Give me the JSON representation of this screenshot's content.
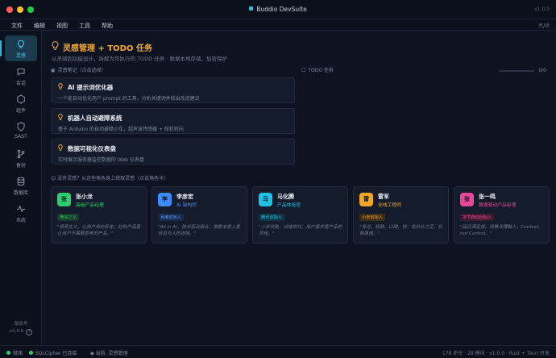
{
  "window": {
    "title": "Buddio DevSuite",
    "version": "v1.0.0",
    "traffic_lights": [
      "#ff5f57",
      "#febc2e",
      "#28c840"
    ]
  },
  "menu": {
    "items": [
      "文件",
      "编辑",
      "视图",
      "工具",
      "帮助"
    ],
    "theme": "亮/暗"
  },
  "sidebar": {
    "items": [
      {
        "label": "灵感",
        "icon": "bulb-icon",
        "active": true
      },
      {
        "label": "会话",
        "icon": "chat-icon"
      },
      {
        "label": "组件",
        "icon": "hexagon-icon"
      },
      {
        "label": "SAST",
        "icon": "shield-icon"
      },
      {
        "label": "备份",
        "icon": "git-branch-icon"
      },
      {
        "label": "数据库",
        "icon": "database-icon"
      },
      {
        "label": "系统",
        "icon": "activity-icon"
      }
    ],
    "footer_label": "版本号",
    "footer_version": "v1.0.0"
  },
  "page": {
    "title": "灵感管理 + TODO 任务",
    "subtitle": "从灵感到功能设计，拆解为可执行的 TODO 任务 · 数据本地存储，加密保护"
  },
  "ideas": {
    "heading": "灵感笔记（点击选择）",
    "items": [
      {
        "title": "AI 提示词优化器",
        "desc": "一个能自动优化用户 prompt 的工具，分析关键词并给出改进建议"
      },
      {
        "title": "机器人自动避障系统",
        "desc": "基于 Arduino 的自动避障小车，超声波传感器 + 舵机转向"
      },
      {
        "title": "数据可视化仪表盘",
        "desc": "实时展示服务器监控数据的 Web 仪表盘"
      }
    ]
  },
  "todo": {
    "heading": "TODO 任务",
    "count": "0/0",
    "progress": 0
  },
  "personas": {
    "cta": "没有灵感？从这些角色身上获取灵感（点击角色卡）",
    "items": [
      {
        "avatar": "张",
        "name": "张小龙",
        "role": "高级产品经理",
        "tag": "微信之父",
        "color": "#2ecc71",
        "quote": "\"极简主义，让用户用完即走；好的产品是让用户不需要思考的产品。\""
      },
      {
        "avatar": "李",
        "name": "李彦宏",
        "role": "AI 架构师",
        "tag": "百度创始人",
        "color": "#3d8bff",
        "quote": "\"All in AI，技术驱动商业；搜索本质上是信息与人的连接。\""
      },
      {
        "avatar": "马",
        "name": "马化腾",
        "role": "产品体验官",
        "tag": "腾讯创始人",
        "color": "#22c1e8",
        "quote": "\"小步快跑，试错迭代；用户需求是产品的灵魂。\""
      },
      {
        "avatar": "雷",
        "name": "雷军",
        "role": "全栈工程师",
        "tag": "小米创始人",
        "color": "#f5a623",
        "quote": "\"专注、极致、口碑、快；性价比之王，价格厚道。\""
      },
      {
        "avatar": "张",
        "name": "张一鸣",
        "role": "数据驱动产品经理",
        "tag": "字节跳动创始人",
        "color": "#e8479a",
        "quote": "\"延迟满足感，用算法理解人；Context, not Control。\""
      }
    ]
  },
  "status": {
    "left": [
      "就绪",
      "SQLCipher 已连接",
      "当前: 灵感管理"
    ],
    "right": "178 命令 · 28 模块 · v1.0.0 · Rust + Tauri 开发"
  }
}
